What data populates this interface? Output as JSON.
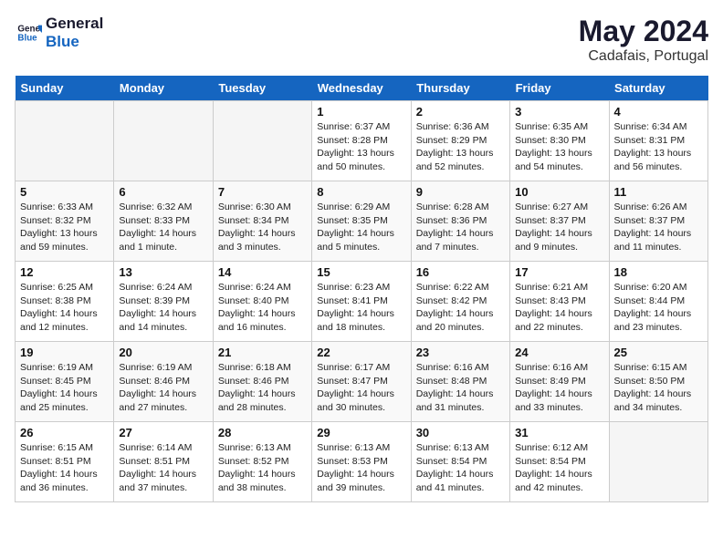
{
  "header": {
    "logo_line1": "General",
    "logo_line2": "Blue",
    "month_title": "May 2024",
    "location": "Cadafais, Portugal"
  },
  "weekdays": [
    "Sunday",
    "Monday",
    "Tuesday",
    "Wednesday",
    "Thursday",
    "Friday",
    "Saturday"
  ],
  "weeks": [
    [
      {
        "day": "",
        "empty": true
      },
      {
        "day": "",
        "empty": true
      },
      {
        "day": "",
        "empty": true
      },
      {
        "day": "1",
        "sunrise": "6:37 AM",
        "sunset": "8:28 PM",
        "daylight": "13 hours and 50 minutes."
      },
      {
        "day": "2",
        "sunrise": "6:36 AM",
        "sunset": "8:29 PM",
        "daylight": "13 hours and 52 minutes."
      },
      {
        "day": "3",
        "sunrise": "6:35 AM",
        "sunset": "8:30 PM",
        "daylight": "13 hours and 54 minutes."
      },
      {
        "day": "4",
        "sunrise": "6:34 AM",
        "sunset": "8:31 PM",
        "daylight": "13 hours and 56 minutes."
      }
    ],
    [
      {
        "day": "5",
        "sunrise": "6:33 AM",
        "sunset": "8:32 PM",
        "daylight": "13 hours and 59 minutes."
      },
      {
        "day": "6",
        "sunrise": "6:32 AM",
        "sunset": "8:33 PM",
        "daylight": "14 hours and 1 minute."
      },
      {
        "day": "7",
        "sunrise": "6:30 AM",
        "sunset": "8:34 PM",
        "daylight": "14 hours and 3 minutes."
      },
      {
        "day": "8",
        "sunrise": "6:29 AM",
        "sunset": "8:35 PM",
        "daylight": "14 hours and 5 minutes."
      },
      {
        "day": "9",
        "sunrise": "6:28 AM",
        "sunset": "8:36 PM",
        "daylight": "14 hours and 7 minutes."
      },
      {
        "day": "10",
        "sunrise": "6:27 AM",
        "sunset": "8:37 PM",
        "daylight": "14 hours and 9 minutes."
      },
      {
        "day": "11",
        "sunrise": "6:26 AM",
        "sunset": "8:37 PM",
        "daylight": "14 hours and 11 minutes."
      }
    ],
    [
      {
        "day": "12",
        "sunrise": "6:25 AM",
        "sunset": "8:38 PM",
        "daylight": "14 hours and 12 minutes."
      },
      {
        "day": "13",
        "sunrise": "6:24 AM",
        "sunset": "8:39 PM",
        "daylight": "14 hours and 14 minutes."
      },
      {
        "day": "14",
        "sunrise": "6:24 AM",
        "sunset": "8:40 PM",
        "daylight": "14 hours and 16 minutes."
      },
      {
        "day": "15",
        "sunrise": "6:23 AM",
        "sunset": "8:41 PM",
        "daylight": "14 hours and 18 minutes."
      },
      {
        "day": "16",
        "sunrise": "6:22 AM",
        "sunset": "8:42 PM",
        "daylight": "14 hours and 20 minutes."
      },
      {
        "day": "17",
        "sunrise": "6:21 AM",
        "sunset": "8:43 PM",
        "daylight": "14 hours and 22 minutes."
      },
      {
        "day": "18",
        "sunrise": "6:20 AM",
        "sunset": "8:44 PM",
        "daylight": "14 hours and 23 minutes."
      }
    ],
    [
      {
        "day": "19",
        "sunrise": "6:19 AM",
        "sunset": "8:45 PM",
        "daylight": "14 hours and 25 minutes."
      },
      {
        "day": "20",
        "sunrise": "6:19 AM",
        "sunset": "8:46 PM",
        "daylight": "14 hours and 27 minutes."
      },
      {
        "day": "21",
        "sunrise": "6:18 AM",
        "sunset": "8:46 PM",
        "daylight": "14 hours and 28 minutes."
      },
      {
        "day": "22",
        "sunrise": "6:17 AM",
        "sunset": "8:47 PM",
        "daylight": "14 hours and 30 minutes."
      },
      {
        "day": "23",
        "sunrise": "6:16 AM",
        "sunset": "8:48 PM",
        "daylight": "14 hours and 31 minutes."
      },
      {
        "day": "24",
        "sunrise": "6:16 AM",
        "sunset": "8:49 PM",
        "daylight": "14 hours and 33 minutes."
      },
      {
        "day": "25",
        "sunrise": "6:15 AM",
        "sunset": "8:50 PM",
        "daylight": "14 hours and 34 minutes."
      }
    ],
    [
      {
        "day": "26",
        "sunrise": "6:15 AM",
        "sunset": "8:51 PM",
        "daylight": "14 hours and 36 minutes."
      },
      {
        "day": "27",
        "sunrise": "6:14 AM",
        "sunset": "8:51 PM",
        "daylight": "14 hours and 37 minutes."
      },
      {
        "day": "28",
        "sunrise": "6:13 AM",
        "sunset": "8:52 PM",
        "daylight": "14 hours and 38 minutes."
      },
      {
        "day": "29",
        "sunrise": "6:13 AM",
        "sunset": "8:53 PM",
        "daylight": "14 hours and 39 minutes."
      },
      {
        "day": "30",
        "sunrise": "6:13 AM",
        "sunset": "8:54 PM",
        "daylight": "14 hours and 41 minutes."
      },
      {
        "day": "31",
        "sunrise": "6:12 AM",
        "sunset": "8:54 PM",
        "daylight": "14 hours and 42 minutes."
      },
      {
        "day": "",
        "empty": true
      }
    ]
  ]
}
